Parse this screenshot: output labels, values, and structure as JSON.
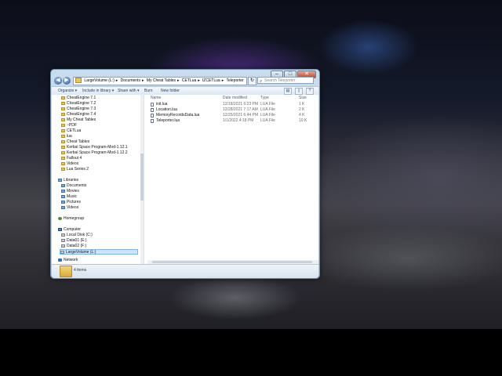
{
  "address_bar": {
    "crumbs": [
      "LargeVolume (L:)",
      "Documents",
      "My Cheat Tables",
      "CETLua",
      "lZCETLua",
      "Teleporter"
    ]
  },
  "search": {
    "placeholder": "Search Teleporter"
  },
  "toolbar": {
    "organize": "Organize ▾",
    "include_in_library": "Include in library ▾",
    "share_with": "Share with ▾",
    "burn": "Burn",
    "new_folder": "New folder"
  },
  "nav_pane": {
    "folders": [
      "CheatEngine 7.1",
      "CheatEngine 7.2",
      "CheatEngine 7.3",
      "CheatEngine 7.4",
      "My Cheat Tables",
      "~PDF",
      "CETLua",
      "lua",
      "Cheat Tables",
      "Kerbal Space Program-Mod-1.12.1",
      "Kerbal Space Program-Mod-1.12.2",
      "Fallout 4",
      "Videos",
      "Lua Series 2"
    ],
    "libraries_label": "Libraries",
    "libraries": [
      "Documents",
      "Movies",
      "Music",
      "Pictures",
      "Videos"
    ],
    "homegroup": "Homegroup",
    "computer_label": "Computer",
    "drives": [
      "Local Disk (C:)",
      "Data01 (E:)",
      "Data02 (F:)",
      "LargeVolume (L:)"
    ],
    "network": "Network"
  },
  "columns": {
    "name": "Name",
    "date": "Date modified",
    "type": "Type",
    "size": "Size"
  },
  "files": [
    {
      "name": "init.lua",
      "date": "12/18/2021 6:23 PM",
      "type": "LUA File",
      "size": "1 K"
    },
    {
      "name": "Location.lua",
      "date": "12/28/2021 7:17 AM",
      "type": "LUA File",
      "size": "2 K"
    },
    {
      "name": "MemoryRecordsData.lua",
      "date": "12/25/2021 6:44 PM",
      "type": "LUA File",
      "size": "4 K"
    },
    {
      "name": "Teleporter.lua",
      "date": "1/1/2022 4:18 PM",
      "type": "LUA File",
      "size": "10 K"
    }
  ],
  "status": {
    "item_count": "4 items"
  }
}
